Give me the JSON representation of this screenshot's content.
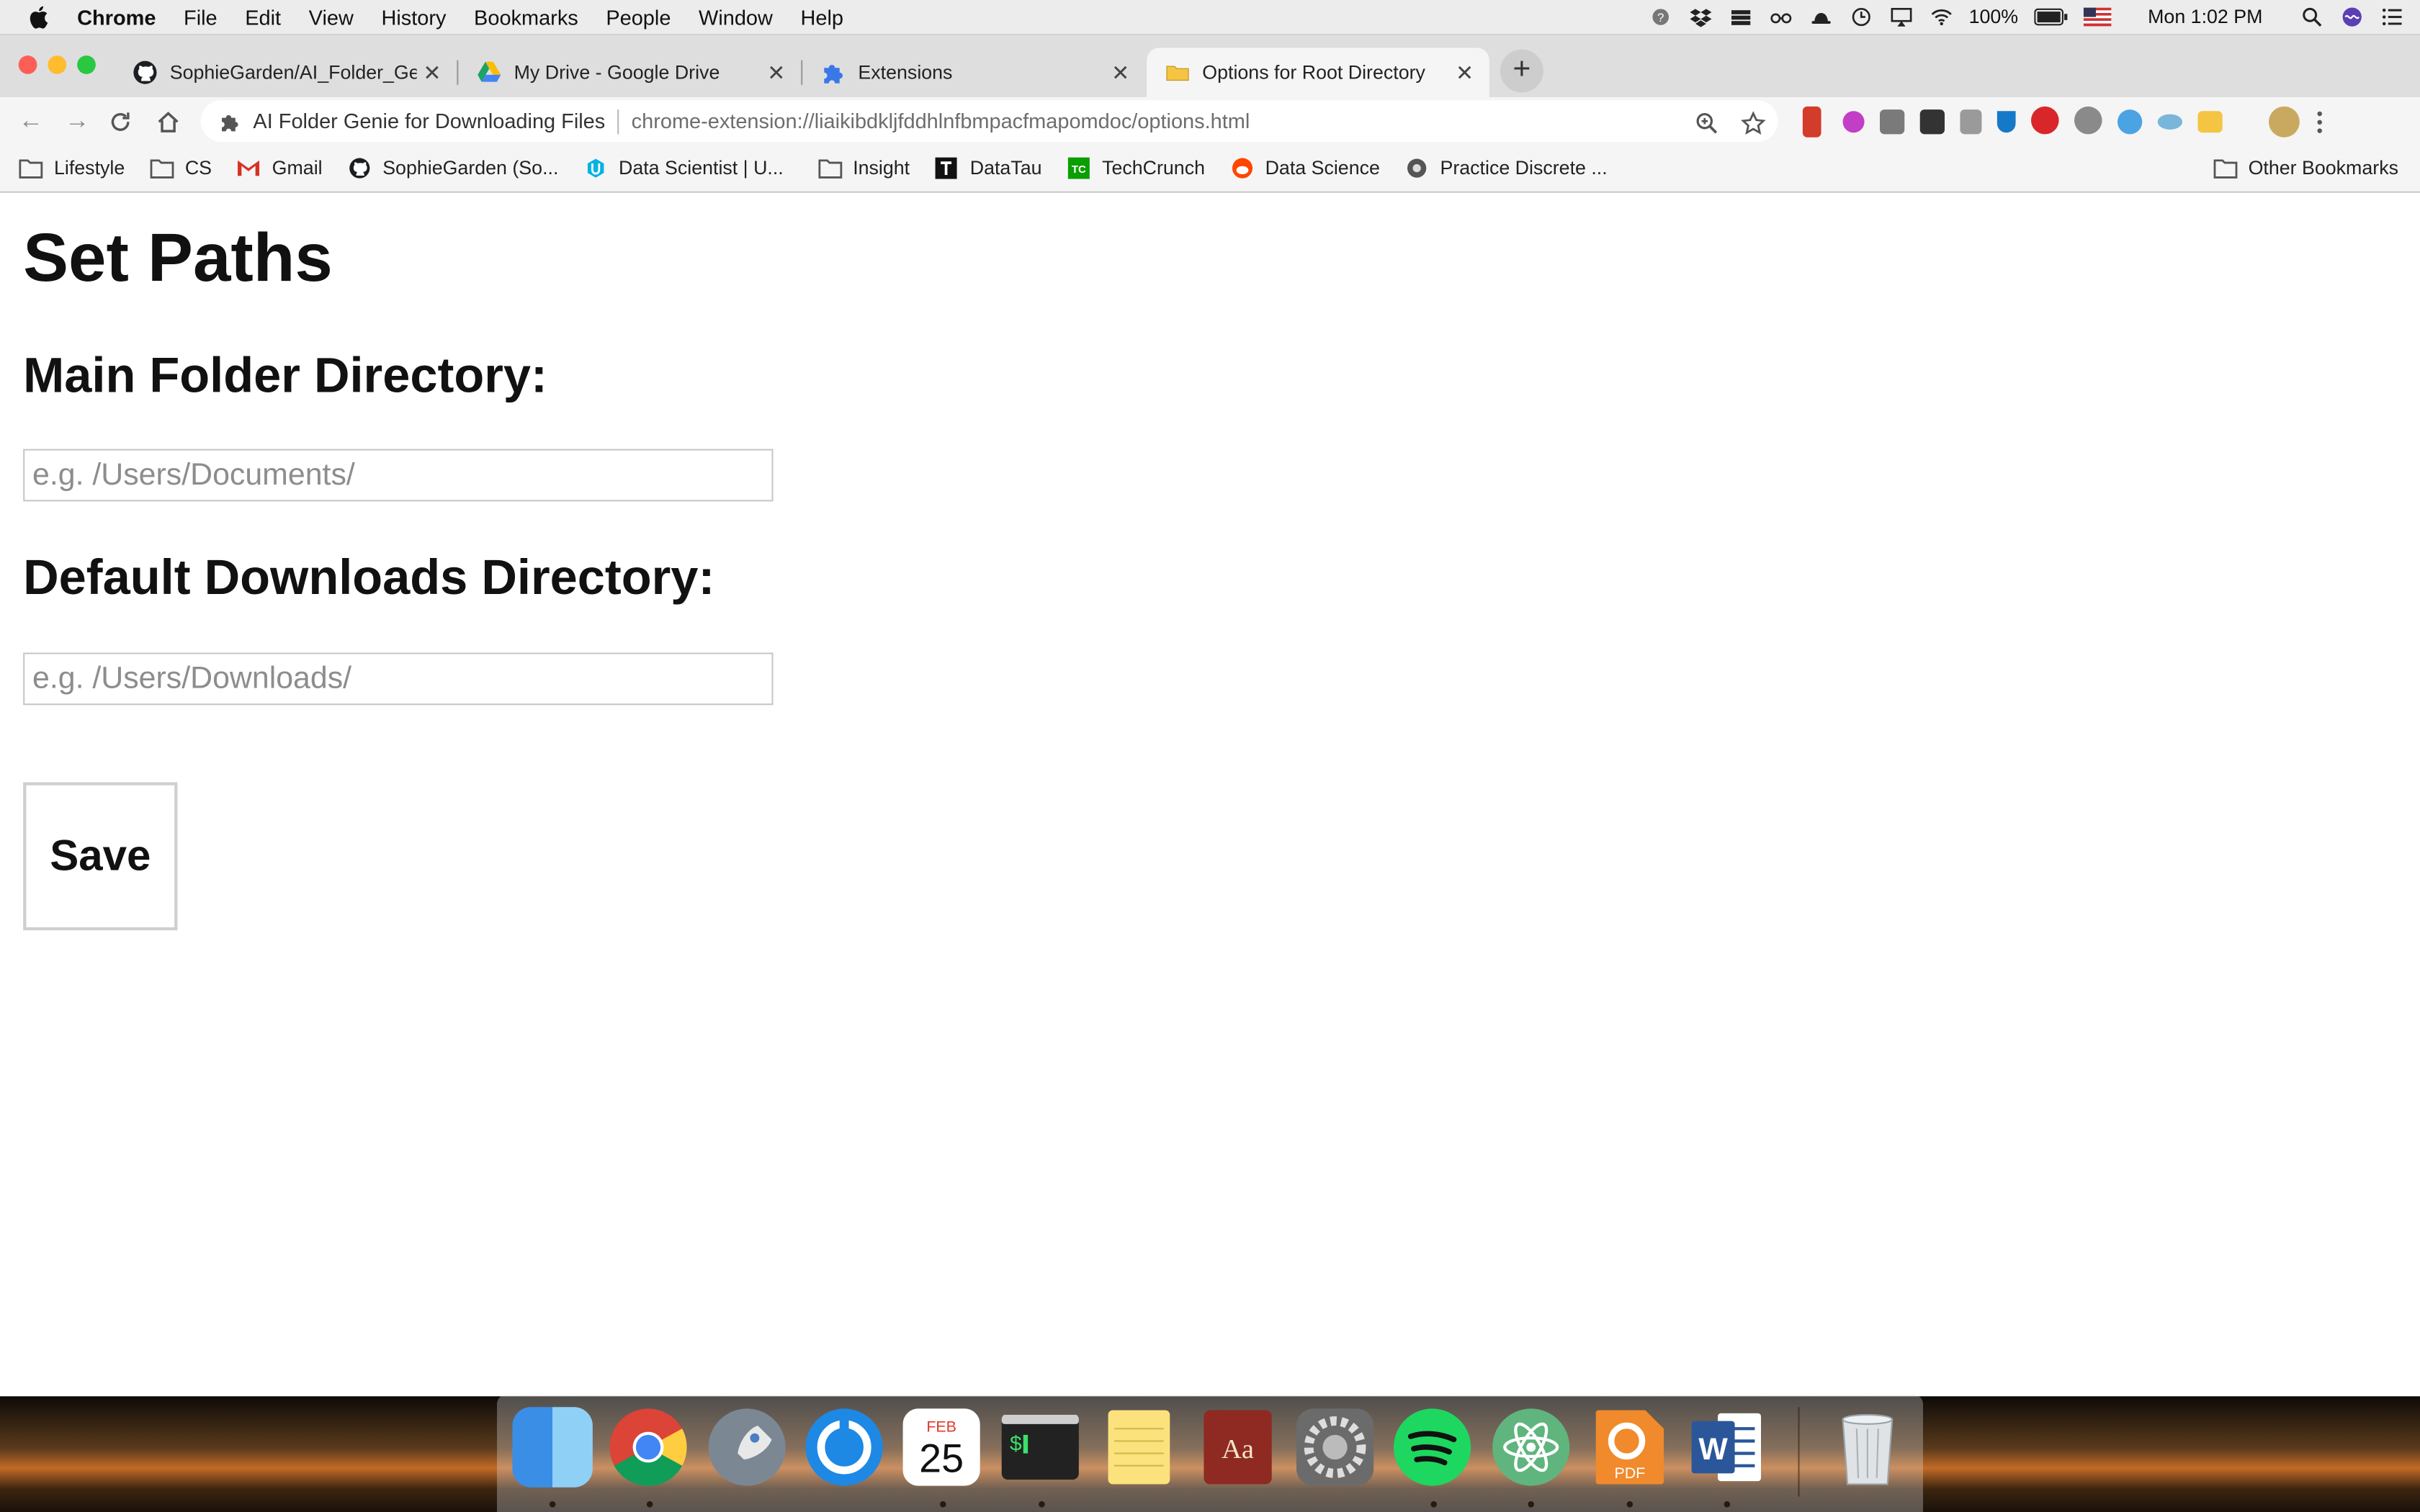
{
  "menubar": {
    "app": "Chrome",
    "items": [
      "File",
      "Edit",
      "View",
      "History",
      "Bookmarks",
      "People",
      "Window",
      "Help"
    ],
    "battery": "100%",
    "clock": "Mon 1:02 PM"
  },
  "tabs": [
    {
      "title": "SophieGarden/AI_Folder_Genie",
      "favicon": "github-icon",
      "active": false
    },
    {
      "title": "My Drive - Google Drive",
      "favicon": "google-drive-icon",
      "active": false
    },
    {
      "title": "Extensions",
      "favicon": "puzzle-icon",
      "active": false
    },
    {
      "title": "Options for Root Directory",
      "favicon": "folder-icon",
      "active": true
    }
  ],
  "omnibox": {
    "extension_name": "AI Folder Genie for Downloading Files",
    "url": "chrome-extension://liaikibdkljfddhlnfbmpacfmapomdoc/options.html"
  },
  "bookmarks": [
    {
      "label": "Lifestyle",
      "icon": "folder-icon"
    },
    {
      "label": "CS",
      "icon": "folder-icon"
    },
    {
      "label": "Gmail",
      "icon": "gmail-icon"
    },
    {
      "label": "SophieGarden (So...",
      "icon": "github-icon"
    },
    {
      "label": "Data Scientist | U...",
      "icon": "udacity-icon"
    },
    {
      "label": "Insight",
      "icon": "folder-icon"
    },
    {
      "label": "DataTau",
      "icon": "datatau-icon"
    },
    {
      "label": "TechCrunch",
      "icon": "techcrunch-icon"
    },
    {
      "label": "Data Science",
      "icon": "reddit-icon"
    },
    {
      "label": "Practice Discrete ...",
      "icon": "gear-badge-icon"
    }
  ],
  "other_bookmarks": "Other Bookmarks",
  "page": {
    "title": "Set Paths",
    "main_label": "Main Folder Directory:",
    "main_placeholder": "e.g. /Users/Documents/",
    "downloads_label": "Default Downloads Directory:",
    "downloads_placeholder": "e.g. /Users/Downloads/",
    "save_label": "Save"
  },
  "dock": {
    "apps": [
      "finder-icon",
      "chrome-icon",
      "launchpad-icon",
      "qbittorrent-icon",
      "calendar-icon",
      "terminal-icon",
      "notes-icon",
      "dictionary-icon",
      "system-preferences-icon",
      "spotify-icon",
      "atom-icon",
      "pdf-expert-icon",
      "word-icon",
      "trash-icon"
    ],
    "calendar_month": "FEB",
    "calendar_day": "25",
    "pdf_label": "PDF",
    "dictionary_label": "Aa",
    "word_label": "W"
  }
}
